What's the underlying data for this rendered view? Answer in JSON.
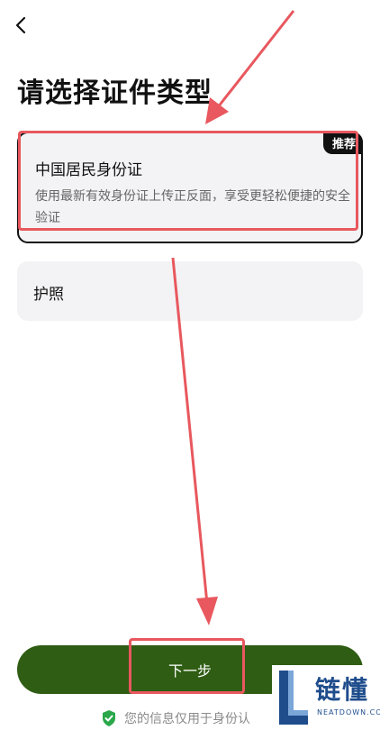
{
  "header": {
    "back_icon": "chevron-left-icon",
    "title": "请选择证件类型"
  },
  "options": [
    {
      "title": "中国居民身份证",
      "description": "使用最新有效身份证上传正反面，享受更轻松便捷的安全验证",
      "badge": "推荐",
      "selected": true
    },
    {
      "title": "护照",
      "selected": false
    }
  ],
  "footer": {
    "next_label": "下一步",
    "privacy_text": "您的信息仅用于身份认",
    "privacy_icon": "shield-check-icon"
  },
  "watermark": {
    "brand": "链懂",
    "domain": "NEATDOWN.COM"
  },
  "colors": {
    "primary_button": "#2f5d14",
    "annotation_red": "#e8585e",
    "card_bg": "#f3f3f5",
    "shield_green": "#2aa84a",
    "watermark_blue": "#1f4d8c"
  }
}
